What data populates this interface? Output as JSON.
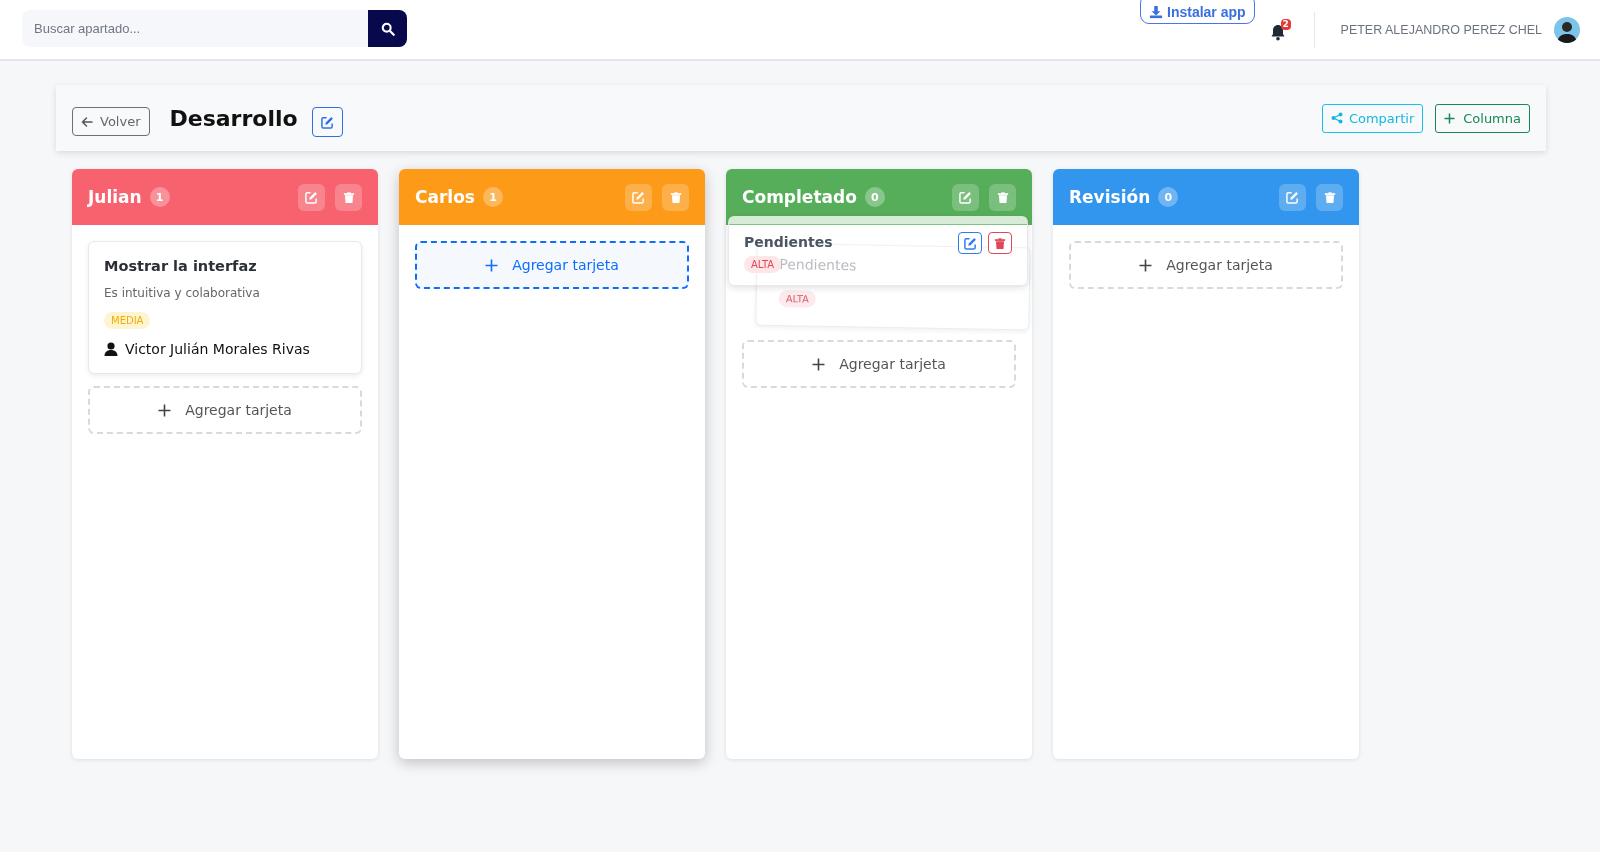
{
  "topbar": {
    "search": {
      "placeholder": "Buscar apartado..."
    },
    "install_button": "Instalar app",
    "notifications": {
      "count": "2"
    },
    "user": {
      "name": "PETER ALEJANDRO PEREZ CHEL"
    }
  },
  "board": {
    "back_button": "Volver",
    "title": "Desarrollo",
    "share_button": "Compartir",
    "add_column_button": "Columna"
  },
  "columns": [
    {
      "name": "Julian",
      "count": "1",
      "color": "#f7626e",
      "drop_target": false,
      "cards": [
        {
          "kind": "card",
          "title": "Mostrar la interfaz",
          "description": "Es intuitiva y colaborativa",
          "priority": {
            "label": "MEDIA",
            "kind": "medium"
          },
          "assignee": "Victor Julián Morales Rivas"
        }
      ],
      "add_card": "Agregar tarjeta"
    },
    {
      "name": "Carlos",
      "count": "1",
      "color": "#fd9a17",
      "drop_target": true,
      "add_card": "Agregar tarjeta"
    },
    {
      "name": "Completado",
      "count": "0",
      "color": "#56ae5a",
      "drop_target": false,
      "cards": [
        {
          "kind": "dragging",
          "title": "Pendientes",
          "priority": {
            "label": "ALTA",
            "kind": "high"
          }
        },
        {
          "kind": "placeholder",
          "title": "Pendientes",
          "priority": {
            "label": "ALTA",
            "kind": "high"
          }
        }
      ],
      "add_card": "Agregar tarjeta"
    },
    {
      "name": "Revisión",
      "count": "0",
      "color": "#3396ee",
      "drop_target": false,
      "add_card": "Agregar tarjeta"
    }
  ]
}
